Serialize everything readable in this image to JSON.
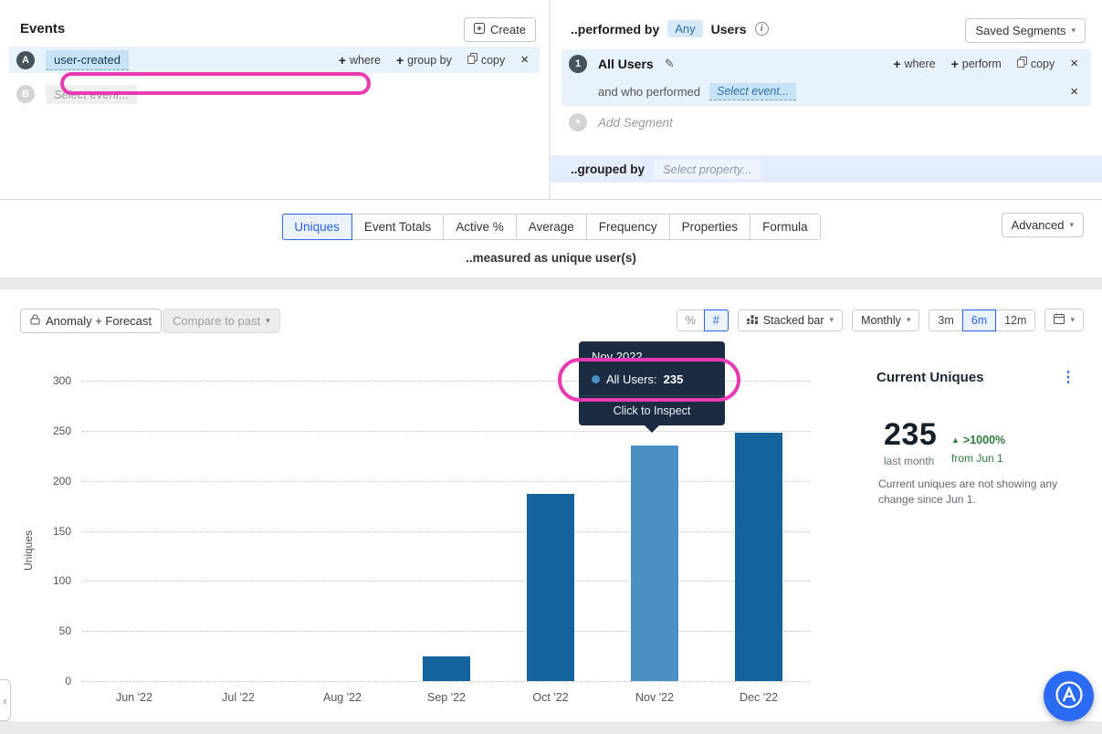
{
  "events_panel": {
    "title": "Events",
    "create_label": "Create",
    "row_a": {
      "letter": "A",
      "event_name": "user-created",
      "where_label": "where",
      "group_by_label": "group by",
      "copy_label": "copy"
    },
    "row_b": {
      "letter": "B",
      "placeholder": "Select event..."
    }
  },
  "segments_panel": {
    "performed_by_label": "..performed by",
    "any_label": "Any",
    "users_label": "Users",
    "saved_segments_label": "Saved Segments",
    "segment": {
      "number": "1",
      "name": "All Users",
      "where_label": "where",
      "perform_label": "perform",
      "copy_label": "copy",
      "and_who_performed_label": "and who performed",
      "select_event_placeholder": "Select event..."
    },
    "add_segment_label": "Add Segment",
    "grouped_by_label": "..grouped by",
    "select_property_placeholder": "Select property..."
  },
  "measure_bar": {
    "tabs": [
      "Uniques",
      "Event Totals",
      "Active %",
      "Average",
      "Frequency",
      "Properties",
      "Formula"
    ],
    "selected_tab": "Uniques",
    "measured_as_label": "..measured as unique user(s)",
    "advanced_label": "Advanced"
  },
  "chart_controls": {
    "anomaly_forecast_label": "Anomaly + Forecast",
    "compare_to_past_label": "Compare to past",
    "percent_label": "%",
    "count_label": "#",
    "chart_type_label": "Stacked bar",
    "interval_label": "Monthly",
    "range_3m": "3m",
    "range_6m": "6m",
    "range_12m": "12m",
    "selected_range": "6m"
  },
  "chart_data": {
    "type": "bar",
    "categories": [
      "Jun '22",
      "Jul '22",
      "Aug '22",
      "Sep '22",
      "Oct '22",
      "Nov '22",
      "Dec '22"
    ],
    "values": [
      0,
      0,
      0,
      25,
      187,
      235,
      248
    ],
    "series_name": "All Users",
    "ylabel": "Uniques",
    "xlabel": "",
    "yticks": [
      0,
      50,
      100,
      150,
      200,
      250,
      300
    ],
    "ylim": [
      0,
      300
    ],
    "grid": "dotted-horizontal",
    "highlight_index": 5,
    "bar_color": "#15639c",
    "bar_highlight_color": "#4a90c4"
  },
  "tooltip": {
    "title": "Nov 2022",
    "series_label": "All Users:",
    "value": "235",
    "action_label": "Click to Inspect",
    "dot_color": "#4a90c4"
  },
  "stats_panel": {
    "title": "Current Uniques",
    "value": "235",
    "period_label": "last month",
    "change_label": ">1000%",
    "change_direction": "up",
    "since_label": "from Jun 1",
    "description": "Current uniques are not showing any change since Jun 1.",
    "change_color": "#2e7d3a"
  },
  "annotations": {
    "color": "#e83bb3"
  },
  "icons": {
    "chevron_down": "▾",
    "close": "×",
    "plus": "+",
    "menu_dots": "⋮",
    "up_triangle": "▲",
    "pencil": "✎",
    "info": "i",
    "collapse_left": "‹"
  }
}
